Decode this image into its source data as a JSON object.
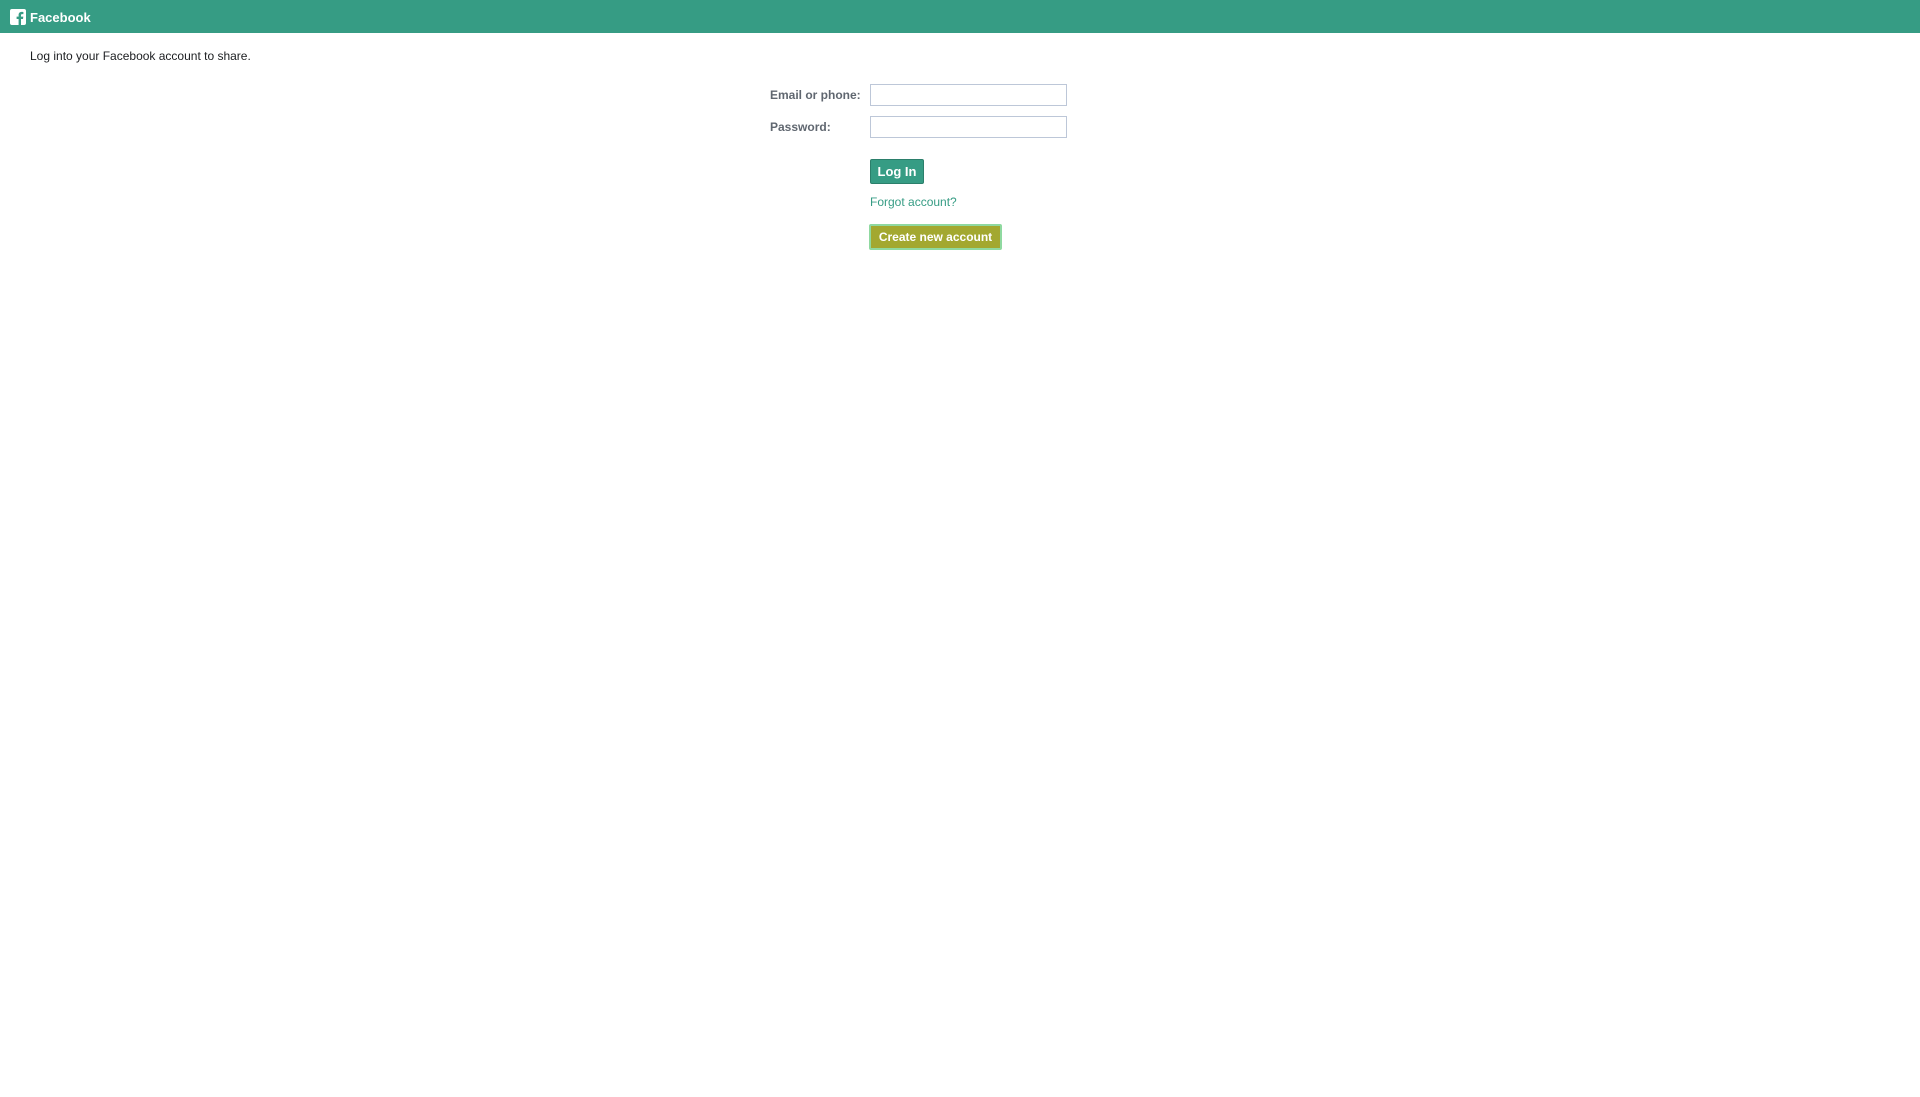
{
  "header": {
    "title": "Facebook",
    "icon": "facebook-logo-icon",
    "bar_color": "#369c84"
  },
  "intro_text": "Log into your Facebook account to share.",
  "login_form": {
    "email_label": "Email or phone:",
    "email_value": "",
    "password_label": "Password:",
    "password_value": "",
    "login_button": "Log In",
    "forgot_link": "Forgot account?",
    "create_button": "Create new account"
  },
  "colors": {
    "accent": "#369c84",
    "create_button": "#a3a830",
    "create_button_border": "#8fd9a0"
  }
}
